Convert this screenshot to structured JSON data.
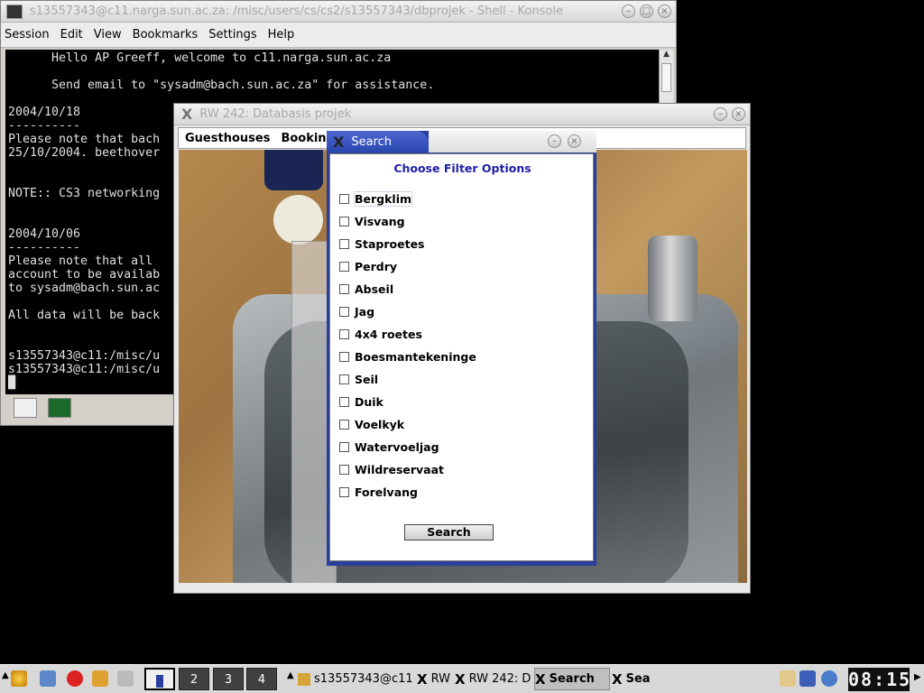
{
  "konsole": {
    "title": "s13557343@c11.narga.sun.ac.za: /misc/users/cs/cs2/s13557343/dbprojek - Shell - Konsole",
    "menu": [
      "Session",
      "Edit",
      "View",
      "Bookmarks",
      "Settings",
      "Help"
    ],
    "terminal_lines": "      Hello AP Greeff, welcome to c11.narga.sun.ac.za\n\n      Send email to \"sysadm@bach.sun.ac.za\" for assistance.\n\n2004/10/18\n----------\nPlease note that bach\n25/10/2004. beethover\n\n\nNOTE:: CS3 networking\n\n\n2004/10/06\n----------\nPlease note that all\naccount to be availab\nto sysadm@bach.sun.ac\n\nAll data will be back\n\n\ns13557343@c11:/misc/u\ns13557343@c11:/misc/u\n█"
  },
  "rw_window": {
    "title": "RW 242: Databasis projek",
    "menu": [
      "Guesthouses",
      "Bookings"
    ]
  },
  "search_dialog": {
    "title": "Search",
    "heading": "Choose Filter Options",
    "options": [
      "Bergklim",
      "Visvang",
      "Staproetes",
      "Perdry",
      "Abseil",
      "Jag",
      "4x4 roetes",
      "Boesmantekeninge",
      "Seil",
      "Duik",
      "Voelkyk",
      "Watervoeljag",
      "Wildreservaat",
      "Forelvang"
    ],
    "checked": [
      false,
      false,
      false,
      false,
      false,
      false,
      false,
      false,
      false,
      false,
      false,
      false,
      false,
      false
    ],
    "search_button": "Search"
  },
  "taskbar": {
    "desktops": [
      "1",
      "2",
      "3",
      "4"
    ],
    "active_desktop": "1",
    "tasks": [
      "s13557343@c11",
      "RW",
      "RW 242: D",
      "Search",
      "Sea"
    ],
    "clock": "08:15"
  }
}
